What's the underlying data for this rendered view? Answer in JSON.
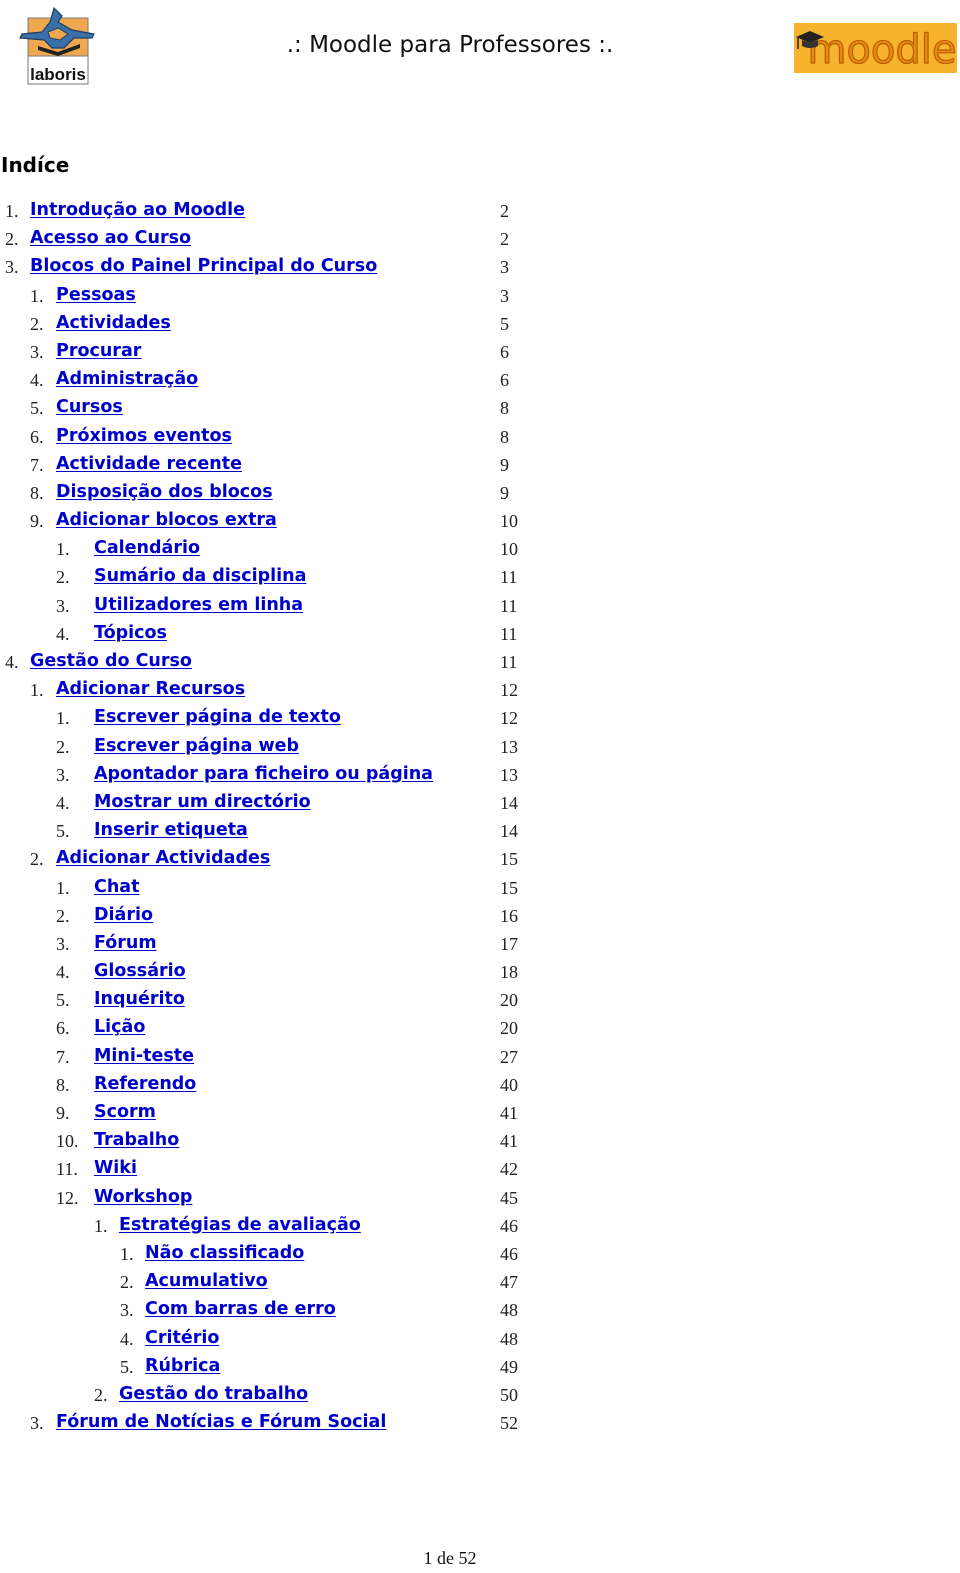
{
  "header": {
    "title": ".: Moodle para Professores :.",
    "left_logo": "laboris-logo",
    "left_logo_text": "laboris",
    "right_logo": "moodle-logo",
    "right_logo_text": "moodle"
  },
  "toc": {
    "heading": "Indíce",
    "entries": [
      {
        "num": "1.",
        "label": "Introdução ao Moodle",
        "page": "2",
        "level": 0
      },
      {
        "num": "2.",
        "label": "Acesso ao Curso",
        "page": "2",
        "level": 0
      },
      {
        "num": "3.",
        "label": "Blocos do Painel Principal do Curso",
        "page": "3",
        "level": 0
      },
      {
        "num": "1.",
        "label": "Pessoas",
        "page": "3",
        "level": 1
      },
      {
        "num": "2.",
        "label": "Actividades",
        "page": "5",
        "level": 1
      },
      {
        "num": "3.",
        "label": "Procurar",
        "page": "6",
        "level": 1
      },
      {
        "num": "4.",
        "label": "Administração",
        "page": "6",
        "level": 1
      },
      {
        "num": "5.",
        "label": "Cursos",
        "page": "8",
        "level": 1
      },
      {
        "num": "6.",
        "label": "Próximos eventos",
        "page": "8",
        "level": 1
      },
      {
        "num": "7.",
        "label": "Actividade recente",
        "page": "9",
        "level": 1
      },
      {
        "num": "8.",
        "label": "Disposição dos blocos",
        "page": "9",
        "level": 1
      },
      {
        "num": "9.",
        "label": "Adicionar blocos extra",
        "page": "10",
        "level": 1
      },
      {
        "num": "1.",
        "label": "Calendário",
        "page": "10",
        "level": 2
      },
      {
        "num": "2.",
        "label": "Sumário da disciplina",
        "page": "11",
        "level": 2
      },
      {
        "num": "3.",
        "label": "Utilizadores em linha",
        "page": "11",
        "level": 2
      },
      {
        "num": "4.",
        "label": "Tópicos",
        "page": "11",
        "level": 2
      },
      {
        "num": "4.",
        "label": "Gestão do Curso",
        "page": "11",
        "level": 0
      },
      {
        "num": "1.",
        "label": "Adicionar Recursos",
        "page": "12",
        "level": 1
      },
      {
        "num": "1.",
        "label": "Escrever página de texto",
        "page": "12",
        "level": 2
      },
      {
        "num": "2.",
        "label": "Escrever página web",
        "page": "13",
        "level": 2
      },
      {
        "num": "3.",
        "label": "Apontador para ficheiro ou página",
        "page": "13",
        "level": 2
      },
      {
        "num": "4.",
        "label": "Mostrar um directório",
        "page": "14",
        "level": 2
      },
      {
        "num": "5.",
        "label": "Inserir etiqueta",
        "page": "14",
        "level": 2
      },
      {
        "num": "2.",
        "label": "Adicionar Actividades",
        "page": "15",
        "level": 1
      },
      {
        "num": "1.",
        "label": "Chat",
        "page": "15",
        "level": 2
      },
      {
        "num": "2.",
        "label": "Diário",
        "page": "16",
        "level": 2
      },
      {
        "num": "3.",
        "label": "Fórum",
        "page": "17",
        "level": 2
      },
      {
        "num": "4.",
        "label": "Glossário",
        "page": "18",
        "level": 2
      },
      {
        "num": "5.",
        "label": "Inquérito",
        "page": "20",
        "level": 2
      },
      {
        "num": "6.",
        "label": "Lição",
        "page": "20",
        "level": 2
      },
      {
        "num": "7.",
        "label": "Mini-teste",
        "page": "27",
        "level": 2
      },
      {
        "num": "8.",
        "label": "Referendo",
        "page": "40",
        "level": 2
      },
      {
        "num": "9.",
        "label": "Scorm",
        "page": "41",
        "level": 2
      },
      {
        "num": "10.",
        "label": "Trabalho",
        "page": "41",
        "level": 2
      },
      {
        "num": "11.",
        "label": "Wiki",
        "page": "42",
        "level": 2
      },
      {
        "num": "12.",
        "label": "Workshop",
        "page": "45",
        "level": 2
      },
      {
        "num": "1.",
        "label": "Estratégias de avaliação",
        "page": "46",
        "level": 3
      },
      {
        "num": "1.",
        "label": "Não classificado",
        "page": "46",
        "level": 4
      },
      {
        "num": "2.",
        "label": "Acumulativo",
        "page": "47",
        "level": 4
      },
      {
        "num": "3.",
        "label": "Com barras de erro",
        "page": "48",
        "level": 4
      },
      {
        "num": "4.",
        "label": "Critério",
        "page": "48",
        "level": 4
      },
      {
        "num": "5.",
        "label": "Rúbrica",
        "page": "49",
        "level": 4
      },
      {
        "num": "2.",
        "label": "Gestão do trabalho",
        "page": "50",
        "level": 3
      },
      {
        "num": "3.",
        "label": "Fórum de Notícias e Fórum Social",
        "page": "52",
        "level": 1
      }
    ]
  },
  "footer": {
    "page_indicator": "1 de 52"
  },
  "colors": {
    "link": "#0000cc",
    "text": "#222222",
    "moodle_orange": "#f7a823"
  }
}
